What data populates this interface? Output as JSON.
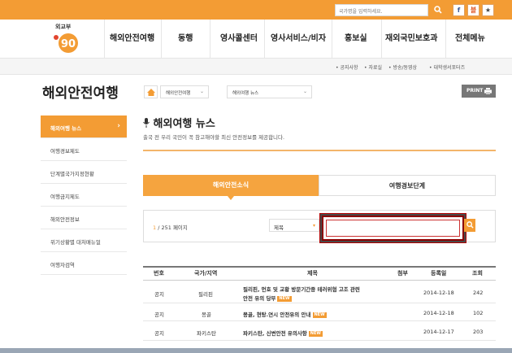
{
  "topbar": {
    "search_placeholder": "국가명을 입력하세요.",
    "search_icon": "magnifier-icon",
    "sns": [
      "f",
      "블",
      "★"
    ]
  },
  "header": {
    "org_name": "외교부",
    "logo_text": "90",
    "nav": [
      "해외안전여행",
      "동행",
      "영사콜센터",
      "영사서비스/비자",
      "홍보실",
      "재외국민보호과",
      "전체메뉴"
    ]
  },
  "sublinks": [
    "• 공지사항",
    "• 자료실",
    "• 방송/동영상",
    "• 대학생서포터즈"
  ],
  "sidebar": {
    "title": "해외안전여행",
    "items": [
      {
        "label": "해외여행 뉴스",
        "active": true
      },
      {
        "label": "여행경보제도",
        "active": false
      },
      {
        "label": "단계별국가지정현황",
        "active": false
      },
      {
        "label": "여행금지제도",
        "active": false
      },
      {
        "label": "해외안전정보",
        "active": false
      },
      {
        "label": "위기상황별 대처매뉴얼",
        "active": false
      },
      {
        "label": "여행자검역",
        "active": false
      }
    ]
  },
  "breadcrumb": {
    "home_icon": "home-icon",
    "level1": "해외안전여행",
    "level2": "해외여행 뉴스"
  },
  "print_label": "PRINT",
  "main": {
    "title": "해외여행 뉴스",
    "description": "출국 전 우리 국민이 꼭 참고해야할 최신 안전정보를 제공합니다."
  },
  "tabs": [
    "해외안전소식",
    "여행경보단계"
  ],
  "search": {
    "page_current": "1",
    "page_rest": "/ 251 페이지",
    "field": "제목",
    "keyword": ""
  },
  "table": {
    "headers": [
      "번호",
      "국가/지역",
      "제목",
      "첨부",
      "등록일",
      "조회"
    ],
    "rows": [
      {
        "no": "공지",
        "country": "필리핀",
        "title_line1": "필리핀, 먼호 및 교황 방문기간중 테러위협 고조 관련",
        "title_line2": "안전 유의 당부",
        "new": "NEW",
        "date": "2014-12-18",
        "views": "242"
      },
      {
        "no": "공지",
        "country": "몽골",
        "title_line1": "몽골, 현탕.연시 안전유의 안내",
        "title_line2": "",
        "new": "NEW",
        "date": "2014-12-18",
        "views": "102"
      },
      {
        "no": "공지",
        "country": "파키스탄",
        "title_line1": "파키스탄, 신변안전 유의사항",
        "title_line2": "",
        "new": "NEW",
        "date": "2014-12-17",
        "views": "203"
      }
    ]
  },
  "colors": {
    "accent": "#f39c34",
    "highlight_border": "#8b0000"
  }
}
